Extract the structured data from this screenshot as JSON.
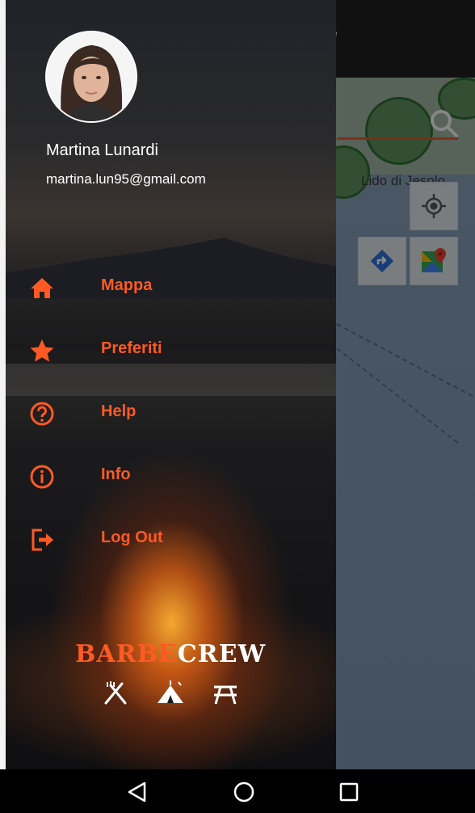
{
  "app": {
    "title_fragment": "/",
    "map": {
      "place_label": "Lido di Jesolo"
    }
  },
  "drawer": {
    "user": {
      "name": "Martina Lunardi",
      "email": "martina.lun95@gmail.com"
    },
    "menu": [
      {
        "label": "Mappa",
        "icon": "home-icon"
      },
      {
        "label": "Preferiti",
        "icon": "star-icon"
      },
      {
        "label": "Help",
        "icon": "help-circle-icon"
      },
      {
        "label": "Info",
        "icon": "info-circle-icon"
      },
      {
        "label": "Log Out",
        "icon": "logout-icon"
      }
    ],
    "brand": {
      "part1": "BARBE",
      "part2": "CREW"
    }
  },
  "colors": {
    "accent": "#ff5a24",
    "drawer_text": "#ffffff",
    "navbar": "#000000"
  },
  "navbar": {
    "icons": [
      "back-icon",
      "home-circle-icon",
      "recents-square-icon"
    ]
  }
}
